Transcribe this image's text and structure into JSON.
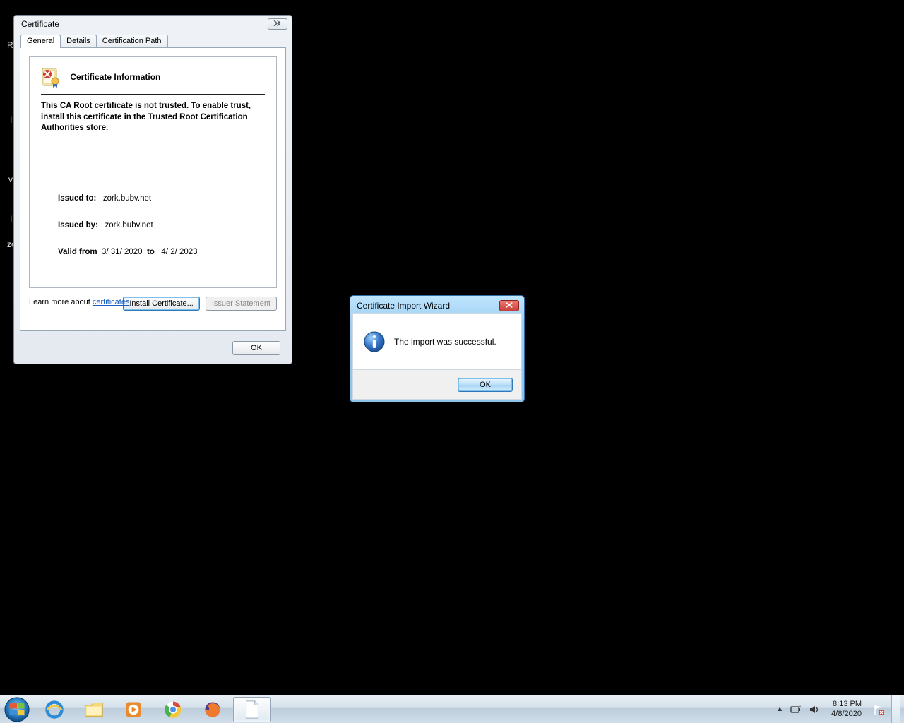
{
  "desktop_fragments": {
    "a": "R",
    "b": "I",
    "c": "v",
    "d": "I",
    "e": "zo"
  },
  "cert": {
    "title": "Certificate",
    "tabs": {
      "general": "General",
      "details": "Details",
      "path": "Certification Path"
    },
    "heading": "Certificate Information",
    "trust_msg": "This CA Root certificate is not trusted. To enable trust, install this certificate in the Trusted Root Certification Authorities store.",
    "issued_to_label": "Issued to:",
    "issued_to": "zork.bubv.net",
    "issued_by_label": "Issued by:",
    "issued_by": "zork.bubv.net",
    "valid_from_label": "Valid from",
    "valid_from": "3/ 31/ 2020",
    "valid_to_label": "to",
    "valid_to": "4/ 2/ 2023",
    "install_btn": "Install Certificate...",
    "issuer_btn": "Issuer Statement",
    "learn_prefix": "Learn more about ",
    "learn_link": "certificates",
    "ok": "OK"
  },
  "wizard": {
    "title": "Certificate Import Wizard",
    "msg": "The import was successful.",
    "ok": "OK"
  },
  "taskbar": {
    "time": "8:13 PM",
    "date": "4/8/2020"
  }
}
